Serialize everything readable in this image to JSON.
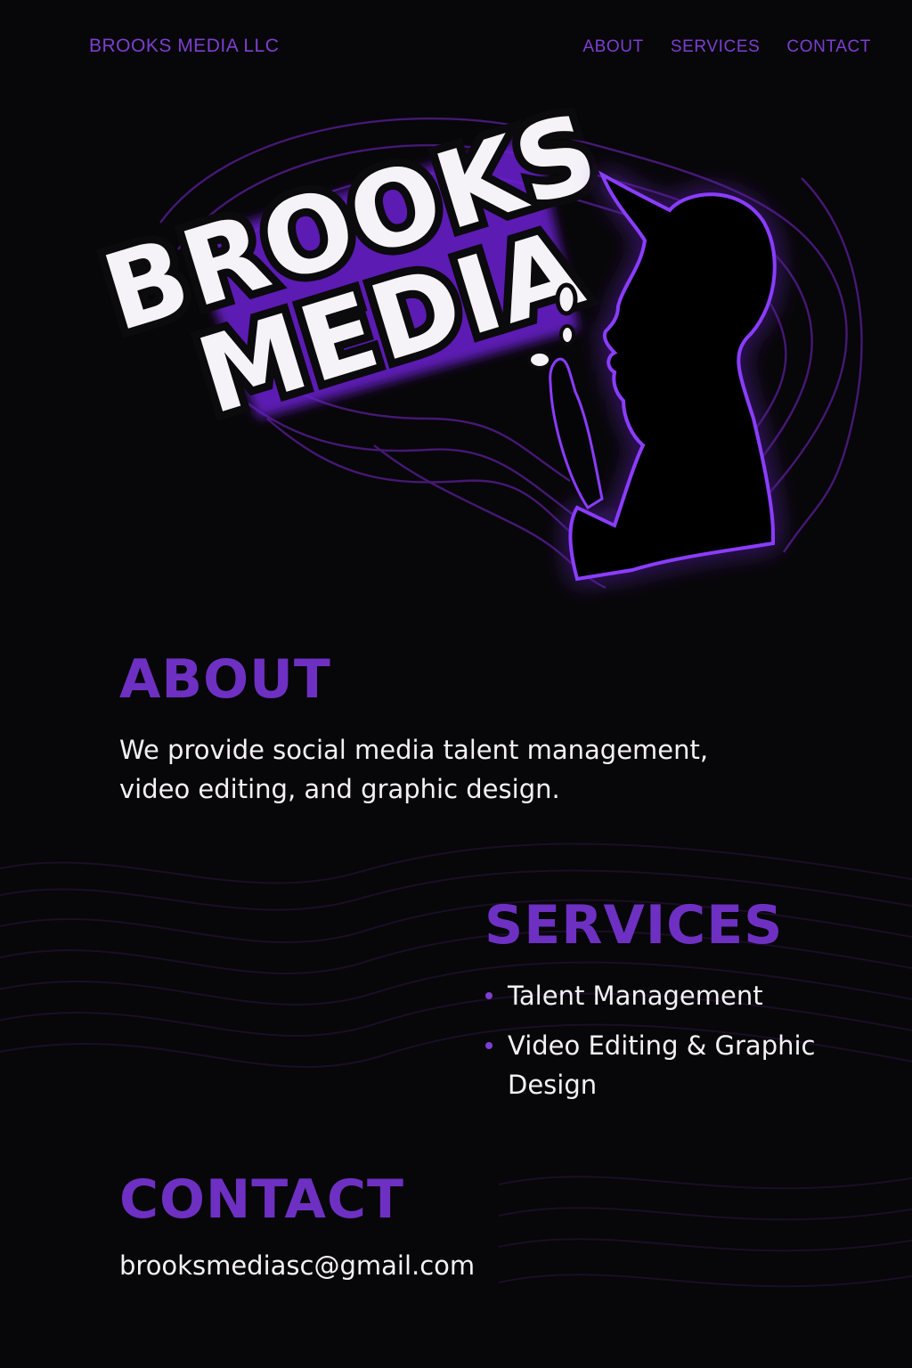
{
  "header": {
    "brand": "BROOKS MEDIA LLC",
    "nav": [
      "ABOUT",
      "SERVICES",
      "CONTACT"
    ]
  },
  "hero": {
    "logo_text_line1": "BROOKS",
    "logo_text_line2": "MEDIA"
  },
  "about": {
    "title": "ABOUT",
    "text": "We provide social media talent management, video editing, and graphic design."
  },
  "services": {
    "title": "SERVICES",
    "items": [
      "Talent Management",
      "Video Editing & Graphic Design"
    ]
  },
  "contact": {
    "title": "CONTACT",
    "email": "brooksmediasc@gmail.com"
  },
  "colors": {
    "background": "#070608",
    "accent_purple": "#6e30c2",
    "nav_purple": "#7d3fd1",
    "glow_purple": "#8a3cff",
    "text_white": "#f3f1f6"
  },
  "icons": [
    "bullet-dot",
    "silhouette-figure",
    "bubble-icons"
  ]
}
